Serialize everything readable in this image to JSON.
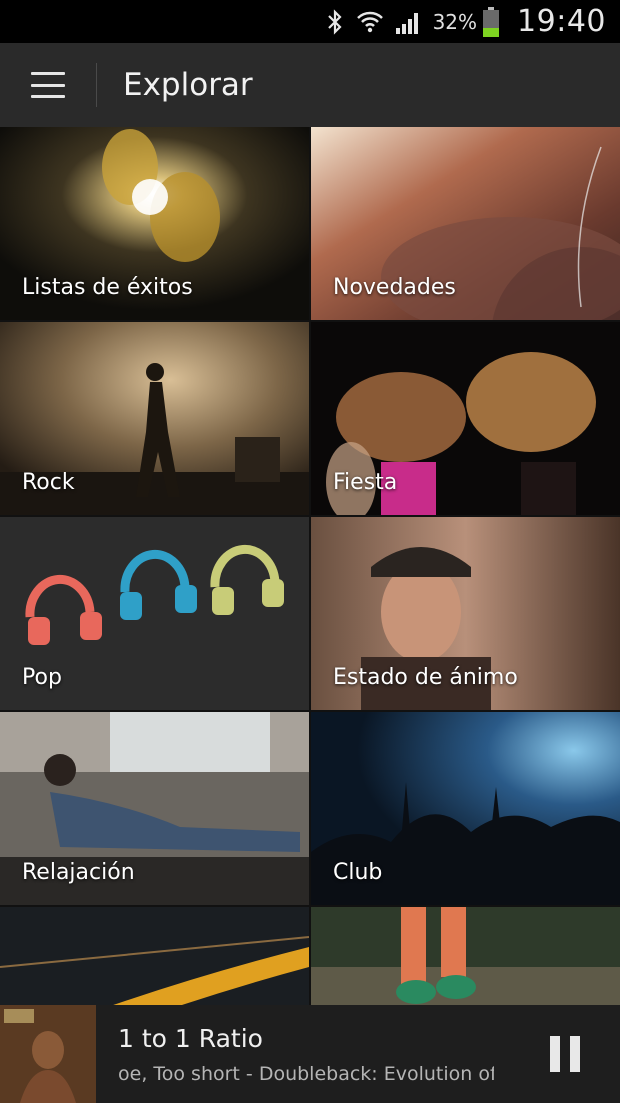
{
  "status_bar": {
    "battery_percent": "32%",
    "time": "19:40",
    "icons": [
      "bluetooth-icon",
      "wifi-icon",
      "signal-icon",
      "battery-icon"
    ]
  },
  "app_bar": {
    "menu_icon": "hamburger-menu-icon",
    "title": "Explorar"
  },
  "categories": [
    {
      "label": "Listas de éxitos"
    },
    {
      "label": "Novedades"
    },
    {
      "label": "Rock"
    },
    {
      "label": "Fiesta"
    },
    {
      "label": "Pop"
    },
    {
      "label": "Estado de ánimo"
    },
    {
      "label": "Relajación"
    },
    {
      "label": "Club"
    },
    {
      "label": ""
    },
    {
      "label": ""
    }
  ],
  "now_playing": {
    "title": "1 to 1 Ratio",
    "subtitle": "oe, Too short - Doubleback: Evolution of R",
    "pause_icon": "pause-icon"
  },
  "colors": {
    "status_bar_bg": "#000000",
    "app_bar_bg": "#2a2a2a",
    "grid_bg": "#121212",
    "now_playing_bg": "#1e1e1e",
    "battery_level": "#7ed321"
  }
}
